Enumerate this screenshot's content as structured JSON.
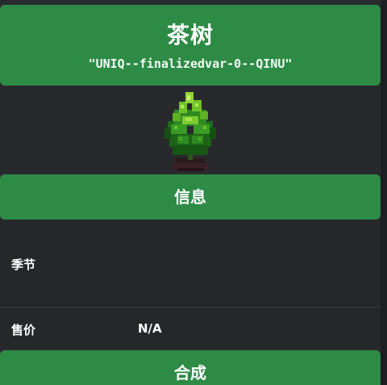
{
  "item": {
    "title": "茶树",
    "internal_id": "\"UNIQ--finalizedvar-0--QINU\""
  },
  "sections": {
    "info_label": "信息",
    "crafting_label": "合成"
  },
  "details": {
    "season_label": "季节",
    "season_value": "",
    "price_label": "售价",
    "price_value": "N/A"
  },
  "colors": {
    "header_green": "#2e8b46",
    "panel_bg": "#2a2b2e",
    "text": "#ffffff"
  },
  "image": {
    "icon": "tea-bush-icon"
  }
}
